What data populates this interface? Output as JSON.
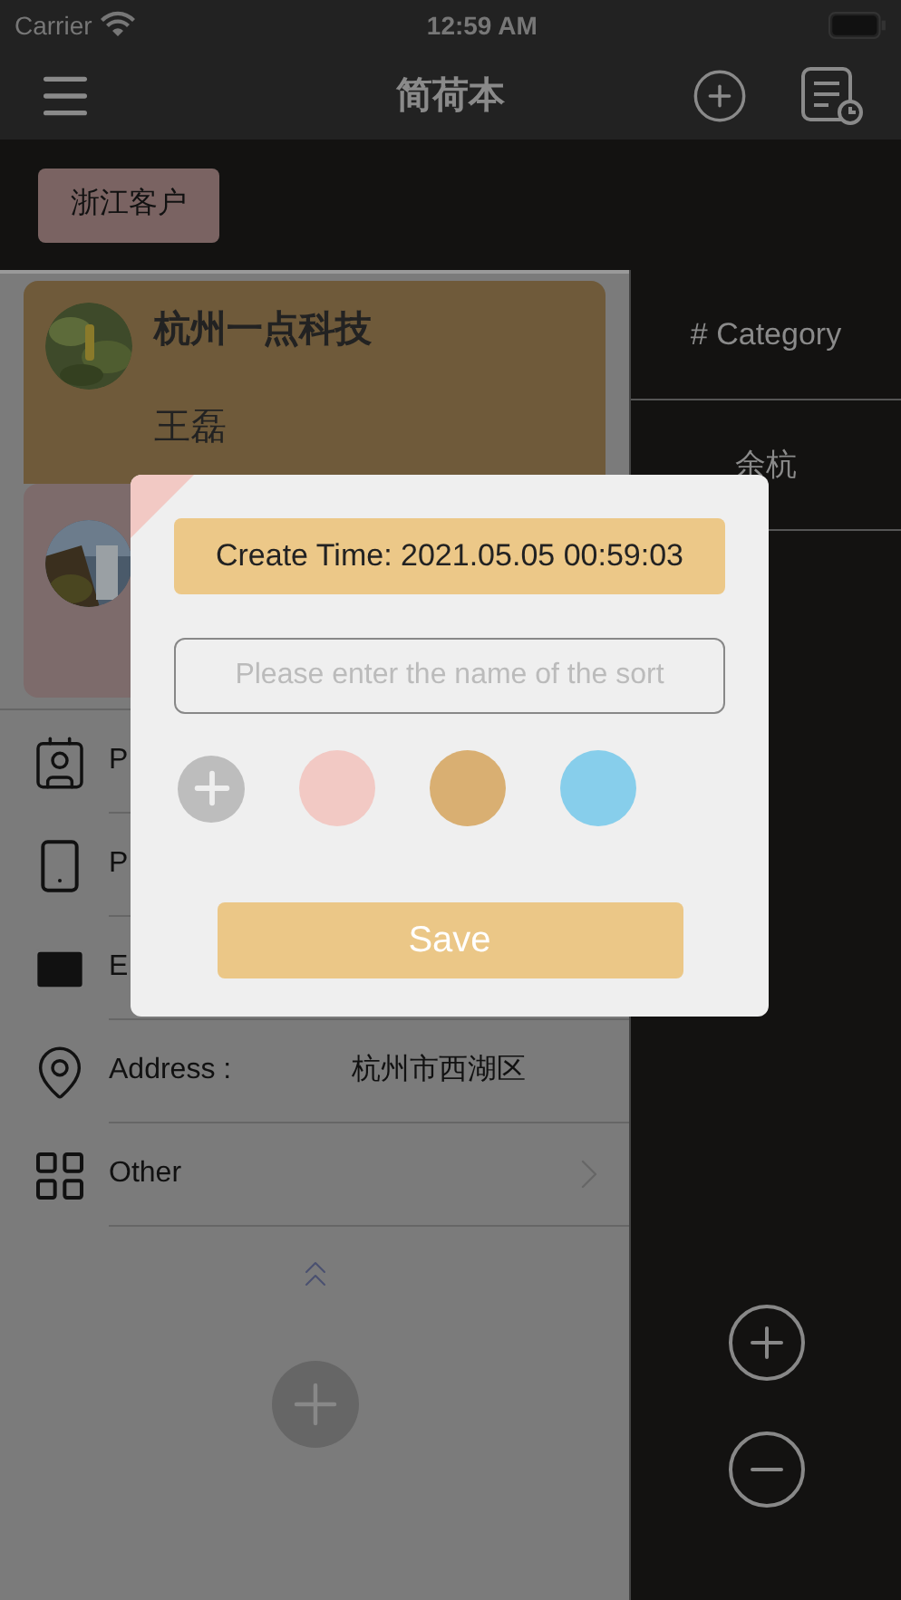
{
  "status_bar": {
    "carrier": "Carrier",
    "time": "12:59 AM"
  },
  "nav": {
    "title": "简荷本"
  },
  "tags": [
    {
      "label": "浙江客户"
    }
  ],
  "cards": [
    {
      "company": "杭州一点科技",
      "name": "王磊",
      "color": "#6f5a3a"
    },
    {
      "color": "#7d6b6b"
    }
  ],
  "fields": [
    {
      "kind": "person",
      "label": "P"
    },
    {
      "kind": "phone",
      "label": "P"
    },
    {
      "kind": "email",
      "label": "E"
    },
    {
      "kind": "address",
      "label": "Address :",
      "value": "杭州市西湖区"
    },
    {
      "kind": "other",
      "label": "Other"
    }
  ],
  "categories": [
    {
      "label": "# Category"
    },
    {
      "label": "余杭"
    }
  ],
  "dialog": {
    "create_time": "Create Time: 2021.05.05 00:59:03",
    "placeholder": "Please enter the name of the sort",
    "colors": [
      {
        "color": "#f2c9c4"
      },
      {
        "color": "#d9af72"
      },
      {
        "color": "#87ceeb"
      }
    ],
    "save": "Save"
  }
}
